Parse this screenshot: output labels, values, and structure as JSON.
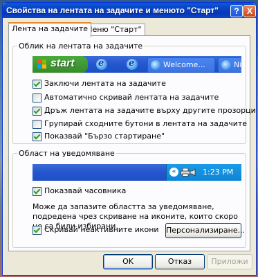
{
  "window": {
    "title": "Свойства на лентата на задачите и менюто \"Старт\"",
    "help_label": "?",
    "close_label": "X"
  },
  "tabs": [
    {
      "label": "Лента на задачите",
      "active": true
    },
    {
      "label": "Меню \"Старт\"",
      "active": false
    }
  ],
  "appearance": {
    "legend": "Облик на лентата на задачите",
    "preview": {
      "start_label": "start",
      "buttons": [
        "Welcome...",
        "Nin"
      ]
    },
    "options": [
      {
        "label": "Заключи лентата на задачите",
        "checked": true
      },
      {
        "label": "Автоматично скривай лентата на задачите",
        "checked": false
      },
      {
        "label": "Дръж лентата на задачите върху другите прозорци",
        "checked": true
      },
      {
        "label": "Групирай сходните бутони в лентата на задачите",
        "checked": false
      },
      {
        "label": "Показвай \"Бързо стартиране\"",
        "checked": true
      }
    ]
  },
  "notification": {
    "legend": "Област на уведомяване",
    "clock": "1:23 PM",
    "tray_arrow": "«",
    "show_clock": {
      "label": "Показвай часовника",
      "checked": true
    },
    "description": "Може да запазите областта за уведомяване, подредена чрез скриване на иконите, които скоро не са били избирани.",
    "hide_inactive": {
      "label": "Скривай неактивните икони",
      "checked": true
    },
    "customize_label": "Персонализиране..."
  },
  "buttons": {
    "ok": "OK",
    "cancel": "Отказ",
    "apply": "Приложи"
  },
  "colors": {
    "title_bar": "#0a47c7",
    "taskbar": "#2456cf",
    "start_button": "#378a2b",
    "tray": "#0f84d6",
    "dialog_face": "#ece9d8"
  }
}
